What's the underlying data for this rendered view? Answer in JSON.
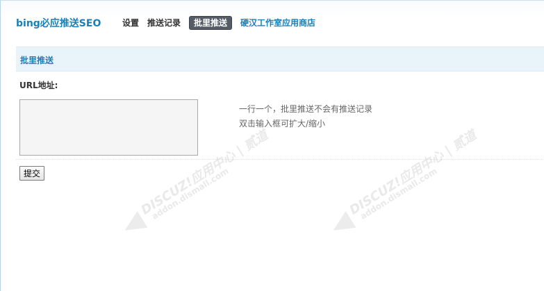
{
  "header": {
    "app_title": "bing必应推送SEO",
    "nav": [
      {
        "label": "设置",
        "active": false
      },
      {
        "label": "推送记录",
        "active": false
      },
      {
        "label": "批里推送",
        "active": true
      },
      {
        "label": "硬汉工作室应用商店",
        "active": false
      }
    ]
  },
  "section": {
    "title": "批里推送"
  },
  "form": {
    "url_label": "URL地址:",
    "url_value": "",
    "tips": [
      "一行一个，批里推送不会有推送记录",
      "双击输入框可扩大/缩小"
    ],
    "submit_label": "提交"
  },
  "watermark": {
    "brand": "DISCUZ!应用中心 | 贰道",
    "site": "addon.dismall.com"
  },
  "colors": {
    "accent": "#1a80b5",
    "active_tab_bg": "#555c66",
    "section_bg": "#e9f3fa"
  }
}
